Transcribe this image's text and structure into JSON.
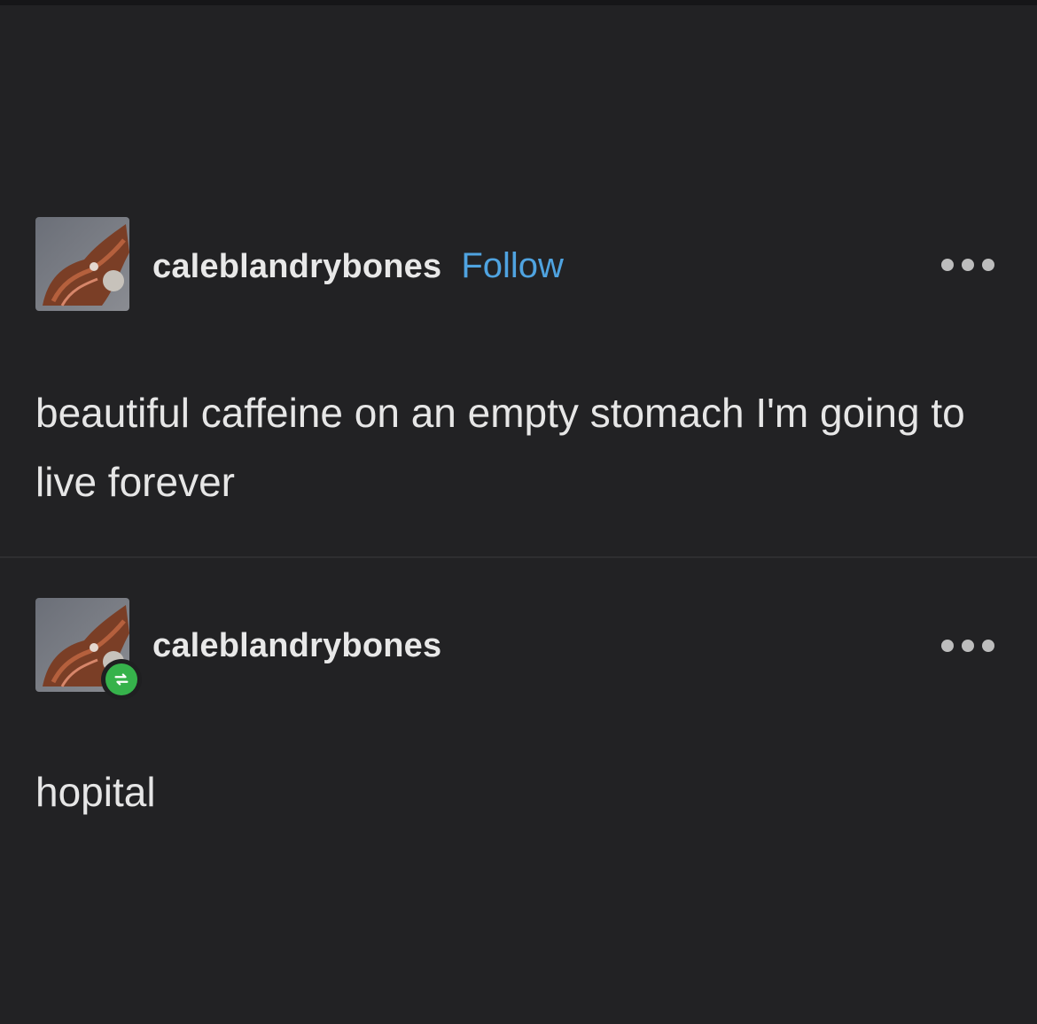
{
  "posts": [
    {
      "username": "caleblandrybones",
      "follow_label": "Follow",
      "body": "beautiful caffeine on an empty stomach I'm going to live forever",
      "reblogged": false
    },
    {
      "username": "caleblandrybones",
      "body": "hopital",
      "reblogged": true
    }
  ],
  "icons": {
    "more": "more-options-icon",
    "reblog": "reblog-icon"
  },
  "colors": {
    "background": "#222224",
    "follow": "#4fa3e0",
    "reblog_badge": "#36b24b"
  }
}
